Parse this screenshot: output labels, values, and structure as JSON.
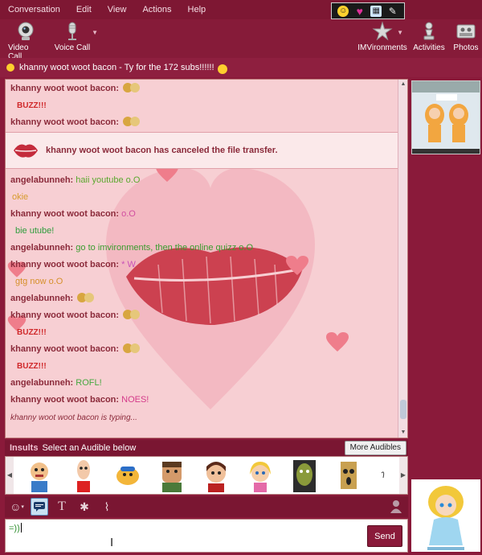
{
  "menu": [
    "Conversation",
    "Edit",
    "View",
    "Actions",
    "Help"
  ],
  "quickbar": {
    "icons": [
      "smiley-icon",
      "heart-icon",
      "calendar-icon",
      "wrench-icon"
    ]
  },
  "toolbar": {
    "video_call": "Video Call",
    "voice_call": "Voice Call",
    "imvironments": "IMVironments",
    "activities": "Activities",
    "photos": "Photos"
  },
  "status": {
    "text": "khanny woot woot bacon - Ty for the 172 subs!!!!!!"
  },
  "chat": {
    "messages_top": [
      {
        "sender": "khanny woot woot bacon:",
        "text": "",
        "emote": true
      },
      {
        "buzz": "BUZZ!!!"
      },
      {
        "sender": "khanny woot woot bacon:",
        "text": "",
        "emote": true
      }
    ],
    "notice": "khanny woot woot bacon has canceled the file transfer.",
    "messages": [
      {
        "sender": "angelabunneh:",
        "text": "haii youtube o.O"
      },
      {
        "sender": "",
        "text": "okie"
      },
      {
        "sender": "khanny woot woot bacon:",
        "text": "o.O"
      },
      {
        "sender": "",
        "text": "bie utube!"
      },
      {
        "sender": "angelabunneh:",
        "text": "go to imvironments, then the online quizz o.O"
      },
      {
        "sender": "khanny woot woot bacon:",
        "text": "* W"
      },
      {
        "sender": "",
        "text": "gtg now o.O"
      },
      {
        "sender": "angelabunneh:",
        "text": "",
        "emote": true
      },
      {
        "sender": "khanny woot woot bacon:",
        "text": "",
        "emote": true
      },
      {
        "buzz": "BUZZ!!!"
      },
      {
        "sender": "khanny woot woot bacon:",
        "text": "",
        "emote": true
      },
      {
        "buzz": "BUZZ!!!"
      },
      {
        "sender": "angelabunneh:",
        "text": "ROFL!"
      },
      {
        "sender": "khanny woot woot bacon:",
        "text": "NOES!"
      }
    ],
    "typing": "khanny woot woot bacon is typing..."
  },
  "audibles": {
    "category": "Insults",
    "hint": "Select an Audible below",
    "more": "More Audibles"
  },
  "input": {
    "value": "=))",
    "send": "Send"
  },
  "colors": {
    "accent": "#8a1a3a",
    "chat_bg": "#f7cfd3",
    "sender": "#8b2a3a",
    "buzz": "#d0282a"
  }
}
